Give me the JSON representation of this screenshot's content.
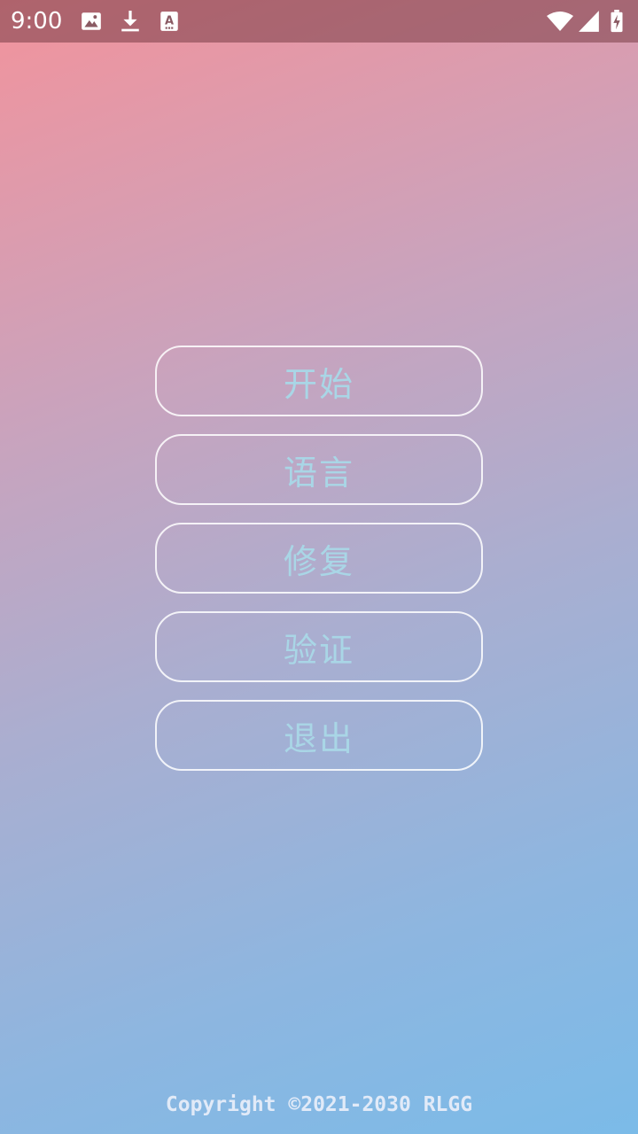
{
  "status_bar": {
    "time": "9:00",
    "icons": [
      "image-icon",
      "download-icon",
      "text-a-icon",
      "wifi-icon",
      "signal-icon",
      "battery-charging-icon"
    ]
  },
  "menu": {
    "items": [
      {
        "label": "开始"
      },
      {
        "label": "语言"
      },
      {
        "label": "修复"
      },
      {
        "label": "验证"
      },
      {
        "label": "退出"
      }
    ]
  },
  "footer": {
    "copyright": "Copyright ©2021-2030 RLGG"
  },
  "colors": {
    "button_text": "#a9d6e6",
    "button_border": "#ffffff",
    "gradient_start": "#f2939c",
    "gradient_end": "#7bbbe8"
  }
}
